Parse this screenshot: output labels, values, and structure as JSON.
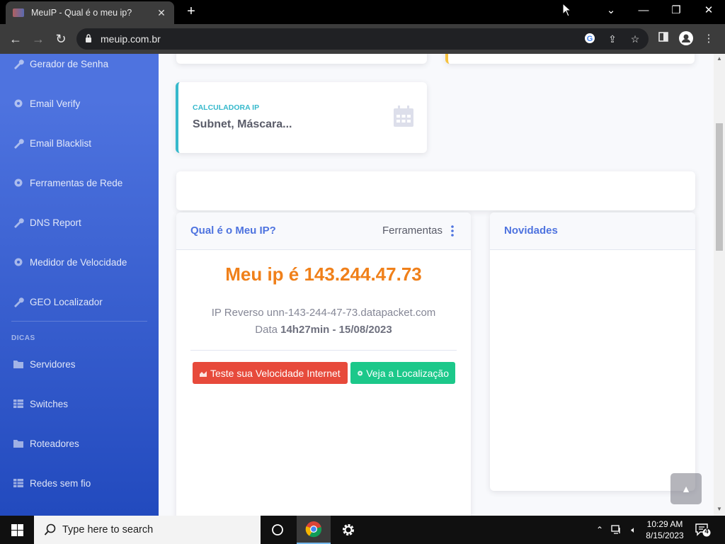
{
  "browser": {
    "tab_title": "MeuIP - Qual é o meu ip?",
    "url": "meuip.com.br"
  },
  "sidebar": {
    "items": [
      {
        "label": "Gerador de Senha",
        "icon": "wrench-icon"
      },
      {
        "label": "Email Verify",
        "icon": "cog-icon"
      },
      {
        "label": "Email Blacklist",
        "icon": "wrench-icon"
      },
      {
        "label": "Ferramentas de Rede",
        "icon": "cog-icon"
      },
      {
        "label": "DNS Report",
        "icon": "wrench-icon"
      },
      {
        "label": "Medidor de Velocidade",
        "icon": "cog-icon"
      },
      {
        "label": "GEO Localizador",
        "icon": "wrench-icon"
      }
    ],
    "heading": "DICAS",
    "tips": [
      {
        "label": "Servidores",
        "icon": "folder-icon"
      },
      {
        "label": "Switches",
        "icon": "table-icon"
      },
      {
        "label": "Roteadores",
        "icon": "folder-icon"
      },
      {
        "label": "Redes sem fio",
        "icon": "table-icon"
      }
    ]
  },
  "calc_card": {
    "label": "CALCULADORA IP",
    "value": "Subnet, Máscara..."
  },
  "ip_card": {
    "title": "Qual é o Meu IP?",
    "tools_label": "Ferramentas",
    "my_ip": "Meu ip é 143.244.47.73",
    "reverse": "IP Reverso unn-143-244-47-73.datapacket.com",
    "date_prefix": "Data ",
    "date_value": "14h27min - 15/08/2023",
    "speed_button": "Teste sua Velocidade Internet",
    "location_button": "Veja a Localização"
  },
  "news_card": {
    "title": "Novidades"
  },
  "taskbar": {
    "search_placeholder": "Type here to search",
    "time": "10:29 AM",
    "date": "8/15/2023",
    "notification_count": "4"
  },
  "colors": {
    "primary": "#4e73df",
    "info": "#36b9cc",
    "warning": "#f6c23e",
    "danger": "#e74a3b",
    "success": "#1cc88a",
    "ip_orange": "#f0801a"
  }
}
